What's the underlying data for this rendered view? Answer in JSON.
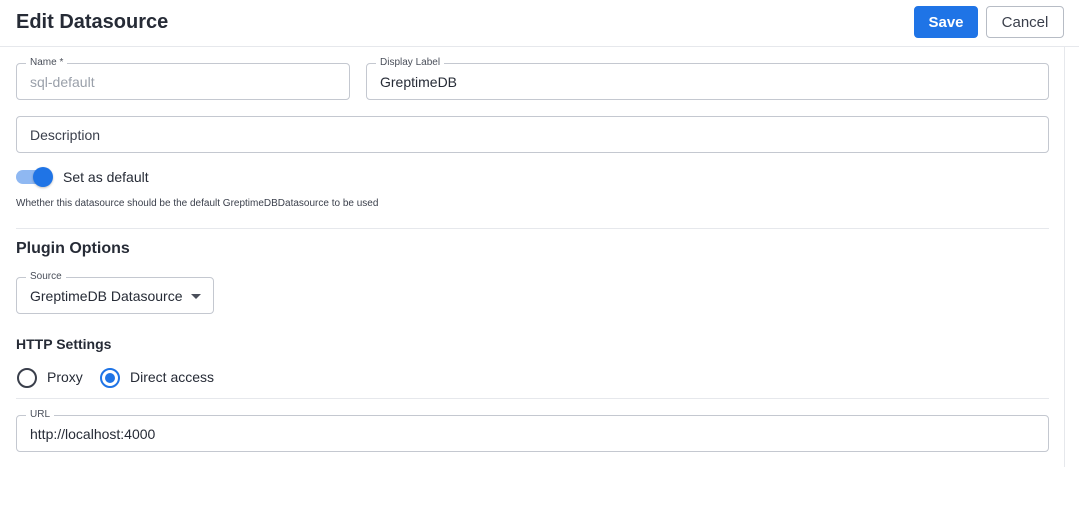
{
  "header": {
    "title": "Edit Datasource",
    "save_label": "Save",
    "cancel_label": "Cancel"
  },
  "form": {
    "name": {
      "label": "Name *",
      "value": "sql-default"
    },
    "display_label": {
      "label": "Display Label",
      "value": "GreptimeDB"
    },
    "description": {
      "value": "Description"
    },
    "default_toggle": {
      "label": "Set as default",
      "on": true,
      "help": "Whether this datasource should be the default GreptimeDBDatasource to be used"
    }
  },
  "plugin_options": {
    "heading": "Plugin Options",
    "source": {
      "label": "Source",
      "value": "GreptimeDB Datasource"
    }
  },
  "http_settings": {
    "heading": "HTTP Settings",
    "options": [
      {
        "label": "Proxy",
        "selected": false
      },
      {
        "label": "Direct access",
        "selected": true
      }
    ],
    "url": {
      "label": "URL",
      "value": "http://localhost:4000"
    }
  },
  "colors": {
    "accent": "#1f74e6",
    "toggle_track": "#8fb8f2",
    "border": "#c4c8d0"
  }
}
